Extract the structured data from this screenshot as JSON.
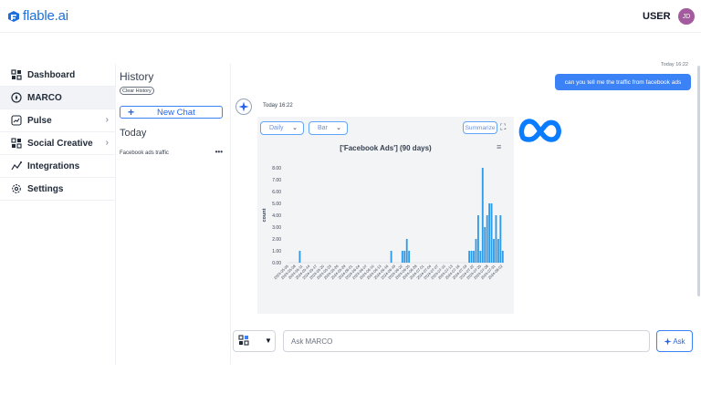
{
  "brand": {
    "name": "flable.ai",
    "color": "#1e6fd9"
  },
  "header": {
    "user_label": "USER",
    "avatar_initials": "JD",
    "avatar_color": "#a35b9d"
  },
  "sidebar": {
    "items": [
      {
        "label": "Dashboard",
        "icon": "dashboard-grid-icon",
        "has_chevron": false
      },
      {
        "label": "MARCO",
        "icon": "compass-icon",
        "has_chevron": false,
        "active": true
      },
      {
        "label": "Pulse",
        "icon": "pulse-chart-icon",
        "has_chevron": true
      },
      {
        "label": "Social Creative",
        "icon": "social-grid-icon",
        "has_chevron": true
      },
      {
        "label": "Integrations",
        "icon": "integrations-icon",
        "has_chevron": false
      },
      {
        "label": "Settings",
        "icon": "gear-icon",
        "has_chevron": false
      }
    ],
    "chevron": "›"
  },
  "history": {
    "title": "History",
    "clear_label": "Clear History",
    "new_chat_label": "New Chat",
    "today_label": "Today",
    "items": [
      {
        "label": "Facebook ads traffic",
        "menu": "•••"
      }
    ]
  },
  "chat": {
    "user_message": {
      "time": "Today 16:22",
      "text": "can you tell me the traffic from facebook ads"
    },
    "bot_message": {
      "time": "Today 16:22"
    },
    "controls": {
      "granularity": "Daily",
      "chart_kind": "Bar",
      "summarize_label": "Summarize"
    }
  },
  "chart_data": {
    "type": "bar",
    "title": "['Facebook Ads'] (90 days)",
    "ylabel": "count",
    "xlabel": "",
    "ylim": [
      0,
      8
    ],
    "yticks": [
      "0.00",
      "1.00",
      "2.00",
      "3.00",
      "4.00",
      "5.00",
      "6.00",
      "7.00",
      "8.00"
    ],
    "bar_color": "#2f9be6",
    "grid": false,
    "x_tick_labels": [
      "2024-05-05",
      "2024-05-08",
      "2024-05-11",
      "2024-05-14",
      "2024-05-17",
      "2024-05-20",
      "2024-05-23",
      "2024-05-26",
      "2024-05-29",
      "2024-06-01",
      "2024-06-04",
      "2024-06-07",
      "2024-06-10",
      "2024-06-13",
      "2024-06-16",
      "2024-06-19",
      "2024-06-22",
      "2024-06-25",
      "2024-06-28",
      "2024-07-01",
      "2024-07-04",
      "2024-07-07",
      "2024-07-10",
      "2024-07-13",
      "2024-07-16",
      "2024-07-19",
      "2024-07-22",
      "2024-07-25",
      "2024-07-28",
      "2024-07-31",
      "2024-08-02"
    ],
    "start_date": "2024-05-05",
    "values": [
      0,
      0,
      0,
      0,
      0,
      1,
      0,
      0,
      0,
      0,
      0,
      0,
      0,
      0,
      0,
      0,
      0,
      0,
      0,
      0,
      0,
      0,
      0,
      0,
      0,
      0,
      0,
      0,
      0,
      0,
      0,
      0,
      0,
      0,
      0,
      0,
      0,
      0,
      0,
      0,
      0,
      0,
      0,
      0,
      0,
      0,
      1,
      0,
      0,
      0,
      0,
      1,
      1,
      2,
      1,
      0,
      0,
      0,
      0,
      0,
      0,
      0,
      0,
      0,
      0,
      0,
      0,
      0,
      0,
      0,
      0,
      0,
      0,
      0,
      0,
      0,
      0,
      0,
      0,
      0,
      0,
      1,
      1,
      1,
      2,
      4,
      1,
      8,
      3,
      4,
      5,
      5,
      2,
      4,
      2,
      4,
      1
    ]
  },
  "composer": {
    "placeholder": "Ask MARCO",
    "ask_label": "Ask"
  },
  "colors": {
    "accent": "#3b82f6",
    "user_bubble": "#3b82f6",
    "chart_bg": "#f3f4f6",
    "meta_blue": "#0a7cff"
  }
}
